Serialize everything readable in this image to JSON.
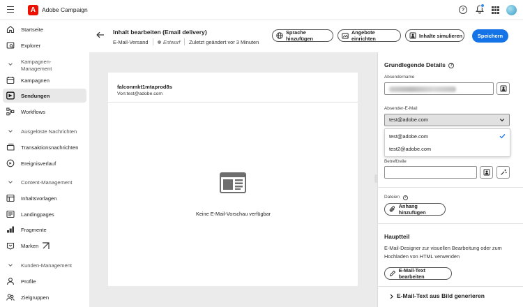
{
  "app": {
    "title": "Adobe Campaign"
  },
  "sidebar": {
    "items": [
      {
        "label": "Startseite",
        "icon": "home-icon"
      },
      {
        "label": "Explorer",
        "icon": "explorer-icon"
      },
      {
        "label": "Kampagnen-Management",
        "section": true,
        "line1": "Kampagnen-",
        "line2": "Management"
      },
      {
        "label": "Kampagnen",
        "icon": "campaign-icon"
      },
      {
        "label": "Sendungen",
        "icon": "send-icon",
        "active": true
      },
      {
        "label": "Workflows",
        "icon": "workflow-icon"
      },
      {
        "label": "Ausgelöste Nachrichten",
        "section": true
      },
      {
        "label": "Transaktionsnachrichten",
        "icon": "transaction-icon"
      },
      {
        "label": "Ereignisverlauf",
        "icon": "history-icon"
      },
      {
        "label": "Content-Management",
        "section": true
      },
      {
        "label": "Inhaltsvorlagen",
        "icon": "template-icon"
      },
      {
        "label": "Landingpages",
        "icon": "landingpage-icon"
      },
      {
        "label": "Fragmente",
        "icon": "fragment-icon"
      },
      {
        "label": "Marken",
        "icon": "brand-icon"
      },
      {
        "label": "Kunden-Management",
        "section": true
      },
      {
        "label": "Profile",
        "icon": "profile-icon"
      },
      {
        "label": "Zielgruppen",
        "icon": "audience-icon"
      }
    ]
  },
  "header": {
    "title": "Inhalt bearbeiten (Email delivery)",
    "type": "E-Mail-Versand",
    "status": "Entwurf",
    "modified": "Zuletzt geändert vor 3 Minuten",
    "buttons": {
      "add_language": "Sprache hinzufügen",
      "offers": "Angebote einrichten",
      "simulate": "Inhalte simulieren",
      "save": "Speichern"
    }
  },
  "preview": {
    "sender_name": "falconmkt1mtaprod8s",
    "from_line": "Von:test@adobe.com",
    "empty_text": "Keine E-Mail-Vorschau verfügbar"
  },
  "panel": {
    "basic_title": "Grundlegende Details",
    "sender_name_label": "Absendername",
    "sender_email_label": "Absender-E-Mail",
    "sender_email_value": "test@adobe.com",
    "dropdown_options": [
      "test@adobe.com",
      "test2@adobe.com"
    ],
    "subject_label": "Betreffzeile",
    "files_label": "Dateien",
    "attach_button": "Anhang hinzufügen",
    "body_title": "Hauptteil",
    "body_text": "E-Mail-Designer zur visuellen Bearbeitung oder zum Hochladen von HTML verwenden",
    "edit_body_button": "E-Mail-Text bearbeiten",
    "generate_title": "E-Mail-Text aus Bild generieren"
  },
  "colors": {
    "primary": "#1473e6",
    "brand": "#eb1000",
    "panel_bg": "#ebebeb"
  }
}
